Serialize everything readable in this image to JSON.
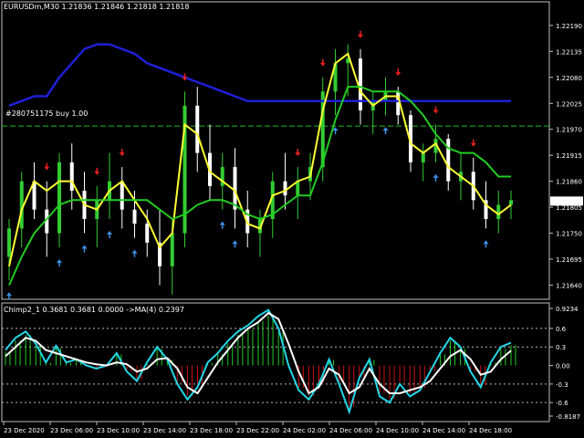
{
  "window": {
    "symbol_header": "EURUSDm,M30  1.21836 1.21846 1.21818 1.21818",
    "order_label": "#280751175 buy 1.00",
    "indicator_header": "Chimp2_1 0.3681 0.3681 0.0000  ->MA(4) 0.2397"
  },
  "colors": {
    "background": "#000000",
    "frame": "#c0c0c0",
    "candle_up": "#33cc33",
    "candle_down": "#ffffff",
    "slow_ma": "#1f1fd6",
    "fast_ma": "#ffff33",
    "band_line": "#22cc22",
    "order_line": "#22bb22",
    "up_arrow": "#3d8fe6",
    "down_arrow": "#e62020",
    "osc_cyan": "#22d7e6",
    "osc_white": "#ffffff",
    "hist_pos": "#22cc22",
    "hist_neg": "#cc1010"
  },
  "chart_data": [
    {
      "type": "candlestick",
      "symbol": "EURUSDm",
      "timeframe": "M30",
      "ylim": [
        1.2161,
        1.2224
      ],
      "yticks": [
        "1.22190",
        "1.22135",
        "1.22080",
        "1.22025",
        "1.21970",
        "1.21915",
        "1.21860",
        "1.21805",
        "1.21750",
        "1.21695",
        "1.21640"
      ],
      "current_price": "1.21818",
      "order_level": 1.21977,
      "xticks": [
        "23 Dec 2020",
        "23 Dec 06:00",
        "23 Dec 10:00",
        "23 Dec 14:00",
        "23 Dec 18:00",
        "23 Dec 22:00",
        "24 Dec 02:00",
        "24 Dec 06:00",
        "24 Dec 10:00",
        "24 Dec 14:00",
        "24 Dec 18:00"
      ],
      "candles": [
        [
          1.217,
          1.2178,
          1.2165,
          1.2176
        ],
        [
          1.2176,
          1.2188,
          1.2172,
          1.2186
        ],
        [
          1.2186,
          1.219,
          1.2178,
          1.218
        ],
        [
          1.218,
          1.2186,
          1.217,
          1.2175
        ],
        [
          1.2175,
          1.2192,
          1.2172,
          1.219
        ],
        [
          1.219,
          1.2194,
          1.218,
          1.2184
        ],
        [
          1.2184,
          1.2188,
          1.2175,
          1.2178
        ],
        [
          1.2178,
          1.2185,
          1.2172,
          1.2182
        ],
        [
          1.2182,
          1.2192,
          1.2178,
          1.2186
        ],
        [
          1.2186,
          1.2189,
          1.2176,
          1.218
        ],
        [
          1.218,
          1.2184,
          1.2174,
          1.2177
        ],
        [
          1.2177,
          1.218,
          1.217,
          1.2173
        ],
        [
          1.2173,
          1.218,
          1.2164,
          1.2168
        ],
        [
          1.2168,
          1.2178,
          1.2162,
          1.2175
        ],
        [
          1.2175,
          1.2205,
          1.2172,
          1.2202
        ],
        [
          1.2202,
          1.2206,
          1.2188,
          1.2192
        ],
        [
          1.2192,
          1.2198,
          1.2182,
          1.2185
        ],
        [
          1.2185,
          1.2192,
          1.218,
          1.2189
        ],
        [
          1.2189,
          1.2193,
          1.2176,
          1.218
        ],
        [
          1.218,
          1.2184,
          1.2172,
          1.2175
        ],
        [
          1.2175,
          1.218,
          1.217,
          1.2178
        ],
        [
          1.2178,
          1.2188,
          1.2174,
          1.2186
        ],
        [
          1.2186,
          1.2192,
          1.218,
          1.2183
        ],
        [
          1.2183,
          1.2189,
          1.2178,
          1.2186
        ],
        [
          1.2186,
          1.2192,
          1.2182,
          1.2189
        ],
        [
          1.2189,
          1.2208,
          1.2186,
          1.2205
        ],
        [
          1.2205,
          1.2214,
          1.22,
          1.2211
        ],
        [
          1.2211,
          1.2215,
          1.2204,
          1.2212
        ],
        [
          1.2212,
          1.2214,
          1.2198,
          1.2201
        ],
        [
          1.2201,
          1.2205,
          1.2196,
          1.2203
        ],
        [
          1.2203,
          1.2208,
          1.22,
          1.2205
        ],
        [
          1.2205,
          1.2206,
          1.2198,
          1.22
        ],
        [
          1.22,
          1.2201,
          1.2188,
          1.219
        ],
        [
          1.219,
          1.2194,
          1.2186,
          1.2192
        ],
        [
          1.2192,
          1.2198,
          1.219,
          1.2195
        ],
        [
          1.2195,
          1.2196,
          1.2184,
          1.2186
        ],
        [
          1.2186,
          1.2192,
          1.2182,
          1.2188
        ],
        [
          1.2188,
          1.2191,
          1.218,
          1.2182
        ],
        [
          1.2182,
          1.2186,
          1.2176,
          1.2178
        ],
        [
          1.2178,
          1.2184,
          1.2175,
          1.2181
        ],
        [
          1.2181,
          1.2184,
          1.2178,
          1.2182
        ]
      ],
      "series": [
        {
          "values": [
            1.2202,
            1.2203,
            1.2204,
            1.2204,
            1.2208,
            1.2211,
            1.2214,
            1.2215,
            1.2215,
            1.2214,
            1.2213,
            1.2211,
            1.221,
            1.2209,
            1.2208,
            1.2207,
            1.2206,
            1.2205,
            1.2204,
            1.2203,
            1.2203,
            1.2203,
            1.2203,
            1.2203,
            1.2203,
            1.2203,
            1.2203,
            1.2203,
            1.2203,
            1.2203,
            1.2203,
            1.2203,
            1.2203,
            1.2203,
            1.2203,
            1.2203,
            1.2203,
            1.2203,
            1.2203,
            1.2203,
            1.2203
          ]
        },
        {
          "values": [
            1.2168,
            1.218,
            1.2186,
            1.2184,
            1.2186,
            1.2186,
            1.2181,
            1.218,
            1.2184,
            1.2186,
            1.2182,
            1.2178,
            1.2172,
            1.2175,
            1.2198,
            1.2196,
            1.2188,
            1.2186,
            1.2184,
            1.2177,
            1.2176,
            1.2183,
            1.2184,
            1.2186,
            1.2187,
            1.2201,
            1.2211,
            1.2213,
            1.2205,
            1.2202,
            1.2204,
            1.2204,
            1.2194,
            1.2192,
            1.2194,
            1.2189,
            1.2187,
            1.2185,
            1.2181,
            1.2179,
            1.2181
          ]
        },
        {
          "values": [
            1.2164,
            1.217,
            1.2175,
            1.2178,
            1.2181,
            1.2182,
            1.2182,
            1.2182,
            1.2182,
            1.2182,
            1.2182,
            1.2182,
            1.218,
            1.2178,
            1.2179,
            1.2181,
            1.2182,
            1.2182,
            1.2181,
            1.2179,
            1.2178,
            1.2179,
            1.2181,
            1.2183,
            1.2183,
            1.219,
            1.2199,
            1.2206,
            1.2206,
            1.2205,
            1.2205,
            1.2205,
            1.2203,
            1.22,
            1.2196,
            1.2193,
            1.2192,
            1.2192,
            1.219,
            1.2187,
            1.2187
          ]
        }
      ],
      "signals": {
        "up": [
          0,
          5,
          7,
          10,
          13,
          21,
          23,
          33,
          37,
          43,
          48
        ],
        "down": [
          4,
          9,
          11,
          17,
          29,
          31,
          35,
          39,
          42,
          46
        ]
      }
    },
    {
      "type": "line",
      "ylim": [
        -0.8187,
        0.9234
      ],
      "yticks": [
        "0.9234",
        "0.6",
        "0.3",
        "0.00",
        "-0.3",
        "-0.6",
        "-0.8187"
      ],
      "levels": [
        0.6,
        0.3,
        -0.3,
        -0.6
      ],
      "series": [
        {
          "name": "Chimp2_1",
          "values": [
            0.25,
            0.45,
            0.55,
            0.35,
            0.05,
            0.32,
            0.05,
            0.1,
            0.0,
            -0.05,
            0.0,
            0.2,
            -0.1,
            -0.25,
            0.05,
            0.3,
            0.1,
            -0.3,
            -0.55,
            -0.35,
            0.05,
            0.2,
            0.4,
            0.55,
            0.65,
            0.8,
            0.9,
            0.6,
            0.0,
            -0.4,
            -0.55,
            -0.3,
            0.1,
            -0.3,
            -0.75,
            -0.2,
            0.1,
            -0.5,
            -0.6,
            -0.3,
            -0.5,
            -0.4,
            -0.1,
            0.2,
            0.45,
            0.3,
            -0.1,
            -0.35,
            0.05,
            0.3,
            0.3684
          ]
        },
        {
          "name": "MA(4)",
          "values": [
            0.15,
            0.3,
            0.45,
            0.4,
            0.25,
            0.2,
            0.15,
            0.1,
            0.05,
            0.02,
            0.0,
            0.05,
            0.02,
            -0.1,
            -0.05,
            0.1,
            0.12,
            -0.05,
            -0.35,
            -0.45,
            -0.2,
            0.05,
            0.25,
            0.45,
            0.6,
            0.7,
            0.85,
            0.75,
            0.35,
            -0.1,
            -0.45,
            -0.35,
            -0.05,
            -0.15,
            -0.45,
            -0.35,
            -0.05,
            -0.3,
            -0.45,
            -0.45,
            -0.4,
            -0.35,
            -0.25,
            -0.05,
            0.15,
            0.25,
            0.1,
            -0.15,
            -0.1,
            0.1,
            0.2397
          ]
        }
      ]
    }
  ]
}
